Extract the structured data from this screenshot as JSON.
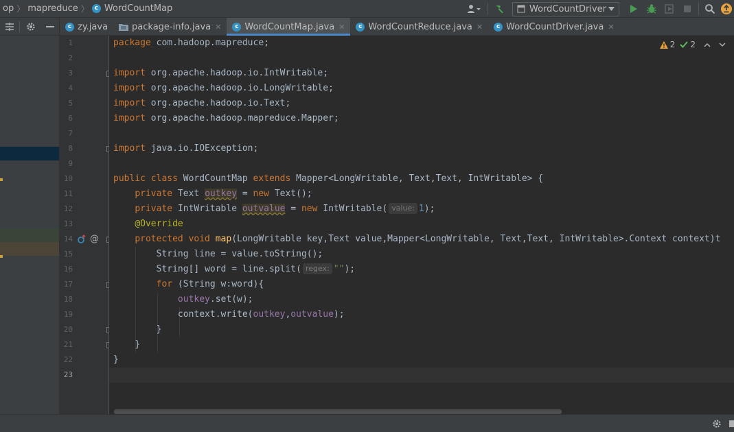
{
  "breadcrumb": {
    "items": [
      "op",
      "mapreduce",
      "WordCountMap"
    ]
  },
  "toolbar": {
    "run_config_label": "WordCountDriver",
    "colors": {
      "build": "#499c54",
      "run": "#499c54",
      "debug": "#499c54",
      "update": "#e8a33e"
    }
  },
  "tabs": [
    {
      "label": "zy.java",
      "icon": "class-icon",
      "active": false
    },
    {
      "label": "package-info.java",
      "icon": "package-icon",
      "active": false
    },
    {
      "label": "WordCountMap.java",
      "icon": "class-icon",
      "active": true
    },
    {
      "label": "WordCountReduce.java",
      "icon": "class-icon",
      "active": false
    },
    {
      "label": "WordCountDriver.java",
      "icon": "class-icon",
      "active": false
    }
  ],
  "inspections": {
    "warnings": "2",
    "weak_warnings": "2"
  },
  "editor": {
    "current_line": 23,
    "line_numbers": [
      "1",
      "2",
      "3",
      "4",
      "5",
      "6",
      "7",
      "8",
      "9",
      "10",
      "11",
      "12",
      "13",
      "14",
      "15",
      "16",
      "17",
      "18",
      "19",
      "20",
      "21",
      "22",
      "23"
    ]
  },
  "code": {
    "l1_kw": "package",
    "l1_rest": " com.hadoop.mapreduce;",
    "l3_kw": "import",
    "l3_rest": " org.apache.hadoop.io.IntWritable;",
    "l4_kw": "import",
    "l4_rest": " org.apache.hadoop.io.LongWritable;",
    "l5_kw": "import",
    "l5_rest": " org.apache.hadoop.io.Text;",
    "l6_kw": "import",
    "l6_rest": " org.apache.hadoop.mapreduce.Mapper;",
    "l8_kw": "import",
    "l8_rest": " java.io.IOException;",
    "l10_kw1": "public class",
    "l10_name": " WordCountMap ",
    "l10_kw2": "extends",
    "l10_rest": " Mapper<LongWritable, Text,Text, IntWritable> {",
    "l11_kw1": "private",
    "l11_type": " Text ",
    "l11_fld": "outkey",
    "l11_mid": " = ",
    "l11_kw2": "new",
    "l11_rest": " Text();",
    "l12_kw1": "private",
    "l12_type": " IntWritable ",
    "l12_fld": "outvalue",
    "l12_mid": " = ",
    "l12_kw2": "new",
    "l12_rest": " IntWritable(",
    "l12_hint": "value:",
    "l12_num": "1",
    "l12_end": ");",
    "l13_ann": "@Override",
    "l14_kw": "protected void",
    "l14_fn": "map",
    "l14_rest": "(LongWritable key,Text value,Mapper<LongWritable, Text,Text, IntWritable>.Context context)t",
    "l15_text": "String line = value.toString();",
    "l16_pre": "String[] word = line.split(",
    "l16_hint": "regex:",
    "l16_str": "\"\"",
    "l16_end": ");",
    "l17_kw": "for",
    "l17_rest": " (String w:word){",
    "l18_fld": "outkey",
    "l18_rest": ".set(w);",
    "l19_pre": "context.write(",
    "l19_f1": "outkey",
    "l19_comma": ",",
    "l19_f2": "outvalue",
    "l19_end": ");",
    "l20_text": "}",
    "l21_text": "}",
    "l22_text": "}"
  }
}
